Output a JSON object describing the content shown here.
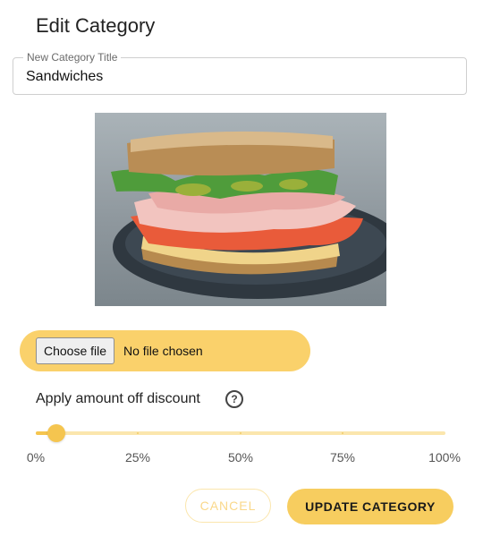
{
  "dialog": {
    "title": "Edit Category"
  },
  "title_field": {
    "label": "New Category Title",
    "value": "Sandwiches"
  },
  "image": {
    "alt": "Sandwiches",
    "icon": "food-photo"
  },
  "file_input": {
    "button_label": "Choose file",
    "status": "No file chosen"
  },
  "discount": {
    "label": "Apply amount off discount",
    "help_icon": "question-circle-icon",
    "value_percent": 5,
    "marks": [
      "0%",
      "25%",
      "50%",
      "75%",
      "100%"
    ]
  },
  "actions": {
    "cancel_label": "CANCEL",
    "update_label": "UPDATE CATEGORY"
  },
  "colors": {
    "accent": "#f5c54f",
    "accent_light": "#fad16b",
    "accent_rail": "#fbe6ad",
    "cancel_text": "#fad88a"
  }
}
